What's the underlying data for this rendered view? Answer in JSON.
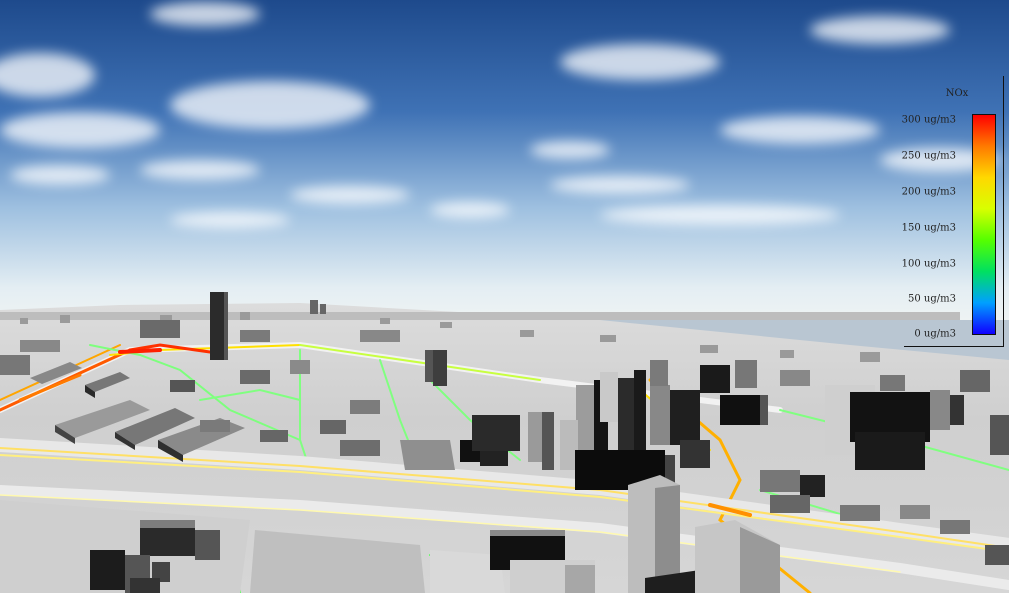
{
  "legend": {
    "title": "NOx",
    "labels": [
      "300 ug/m3",
      "250 ug/m3",
      "200 ug/m3",
      "150 ug/m3",
      "100 ug/m3",
      "50 ug/m3",
      "0 ug/m3"
    ],
    "colors": [
      "#ff0000",
      "#ff7a00",
      "#ffd800",
      "#d8ff00",
      "#55ff00",
      "#00e060",
      "#00a0ff",
      "#1000ff"
    ]
  }
}
